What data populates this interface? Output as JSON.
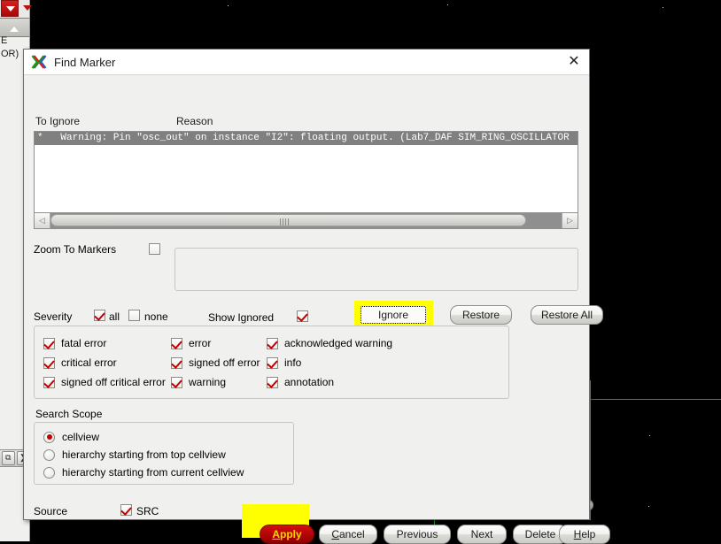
{
  "window": {
    "title": "Find Marker",
    "app_icon": "virtuoso-x-icon",
    "close_label": "✕"
  },
  "list": {
    "col_to_ignore": "To Ignore",
    "col_reason": "Reason",
    "rows": [
      "*   Warning: Pin \"osc_out\" on instance \"I2\": floating output. (Lab7_DAF SIM_RING_OSCILLATOR"
    ]
  },
  "scrollbar": {
    "left_arrow": "◁",
    "right_arrow": "▷"
  },
  "zoom_to_markers": {
    "label": "Zoom To Markers",
    "checked": false
  },
  "ignore_group": {
    "show_ignored_label": "Show Ignored",
    "show_ignored_checked": true,
    "ignore_button": "Ignore",
    "restore_button": "Restore",
    "restore_all_button": "Restore All",
    "highlight_color": "#ffff00"
  },
  "severity": {
    "label": "Severity",
    "all_label": "all",
    "all_checked": true,
    "none_label": "none",
    "none_checked": false,
    "items": [
      {
        "label": "fatal error",
        "checked": true
      },
      {
        "label": "error",
        "checked": true
      },
      {
        "label": "acknowledged warning",
        "checked": true
      },
      {
        "label": "critical error",
        "checked": true
      },
      {
        "label": "signed off error",
        "checked": true
      },
      {
        "label": "info",
        "checked": true
      },
      {
        "label": "signed off critical error",
        "checked": true
      },
      {
        "label": "warning",
        "checked": true
      },
      {
        "label": "annotation",
        "checked": true
      }
    ]
  },
  "search_scope": {
    "label": "Search Scope",
    "options": [
      {
        "label": "cellview",
        "selected": true
      },
      {
        "label": "hierarchy starting from top cellview",
        "selected": false
      },
      {
        "label": "hierarchy starting from current cellview",
        "selected": false
      }
    ]
  },
  "source": {
    "label": "Source",
    "src_label": "SRC",
    "src_checked": true
  },
  "actions": {
    "apply": {
      "label": "Apply",
      "mnemonic": "A",
      "highlight_color": "#ffff00",
      "fill_color": "#b00404",
      "text_color": "#ffd400"
    },
    "cancel": {
      "label": "Cancel",
      "mnemonic": "C"
    },
    "previous": {
      "label": "Previous",
      "mnemonic": ""
    },
    "next": {
      "label": "Next",
      "mnemonic": ""
    },
    "delete": {
      "label": "Delete",
      "mnemonic": ""
    },
    "help": {
      "label": "Help",
      "mnemonic": "H"
    }
  },
  "background": {
    "canvas_color": "#000000",
    "panel_color": "#f0f0ee",
    "marker_line_color": "#19a319",
    "left_text_1": "E",
    "left_text_2": "OR)",
    "mini_button_1": "⧉",
    "mini_button_2": "❯"
  }
}
